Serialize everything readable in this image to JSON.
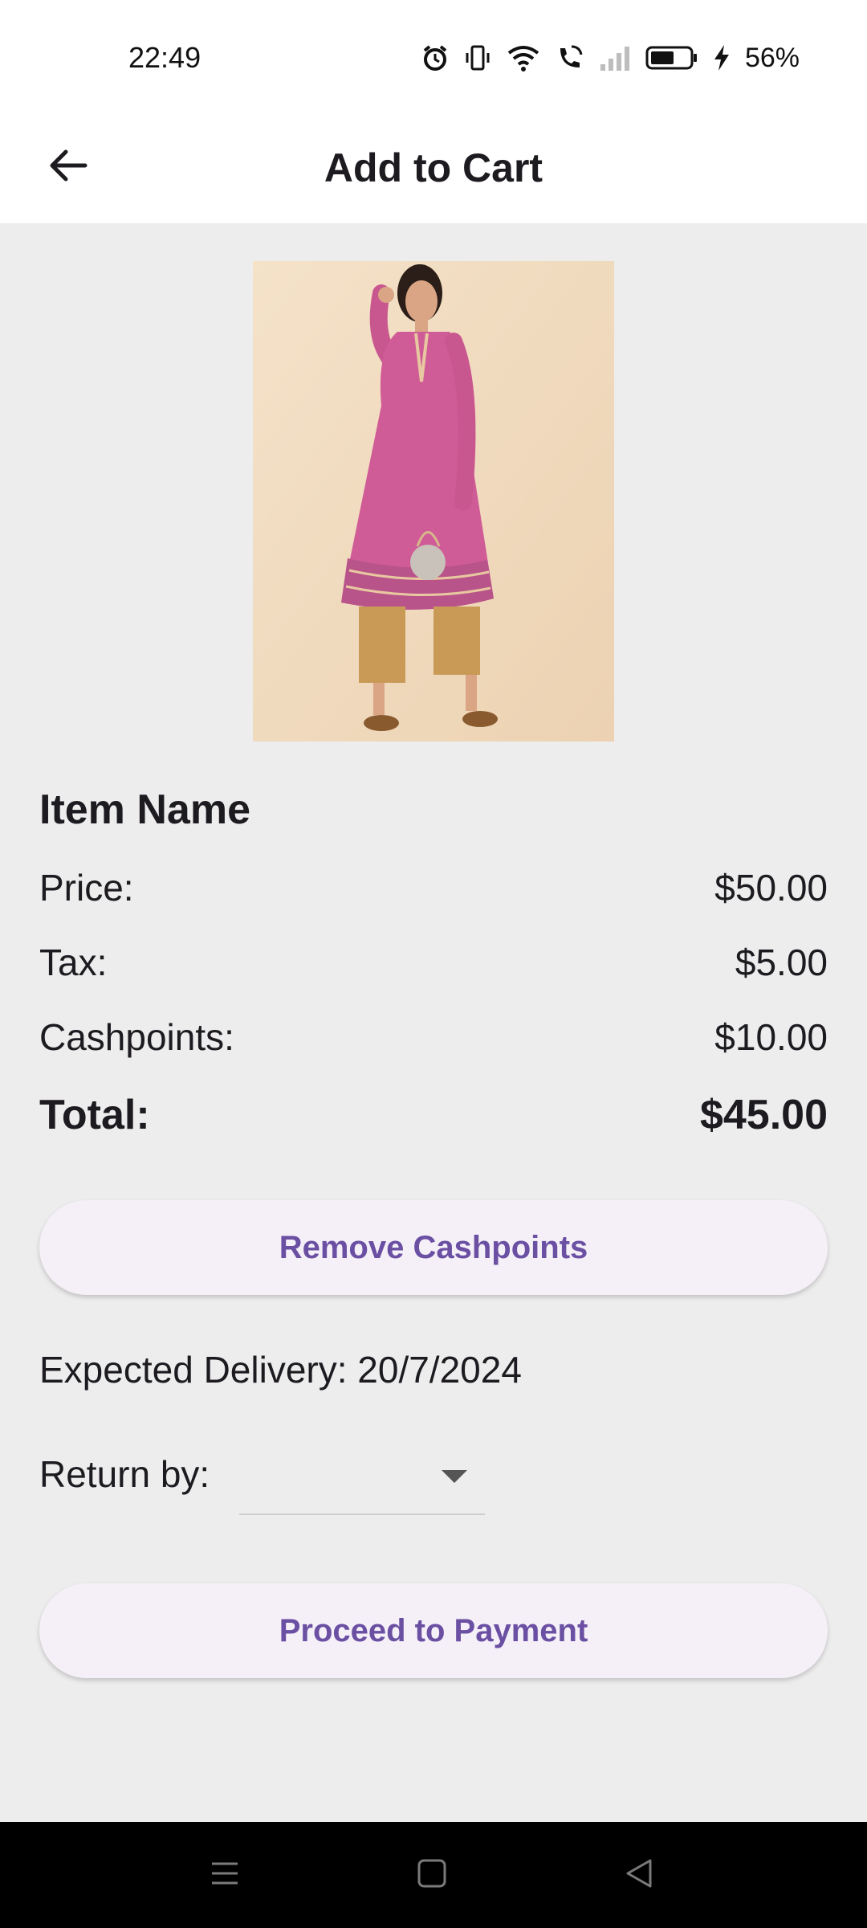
{
  "status_bar": {
    "time": "22:49",
    "battery": "56%",
    "icons": [
      "alarm-icon",
      "vibrate-icon",
      "wifi-icon",
      "wifi-calling-icon",
      "signal-icon",
      "battery-icon",
      "charging-icon"
    ]
  },
  "app_bar": {
    "title": "Add to Cart",
    "back_icon": "arrow-left-icon"
  },
  "product": {
    "image": "product-photo-pink-kurta",
    "name": "Item Name"
  },
  "summary": {
    "price_label": "Price:",
    "price_value": "$50.00",
    "tax_label": "Tax:",
    "tax_value": "$5.00",
    "cashpoints_label": "Cashpoints:",
    "cashpoints_value": "$10.00",
    "total_label": "Total:",
    "total_value": "$45.00"
  },
  "actions": {
    "remove_cashpoints": "Remove Cashpoints",
    "proceed": "Proceed to Payment"
  },
  "delivery": {
    "text": "Expected Delivery: 20/7/2024"
  },
  "return": {
    "label": "Return by:",
    "selected": ""
  },
  "colors": {
    "accent_text": "#6a4fa3",
    "button_bg": "#f5f0f8",
    "page_bg": "#ededed"
  }
}
